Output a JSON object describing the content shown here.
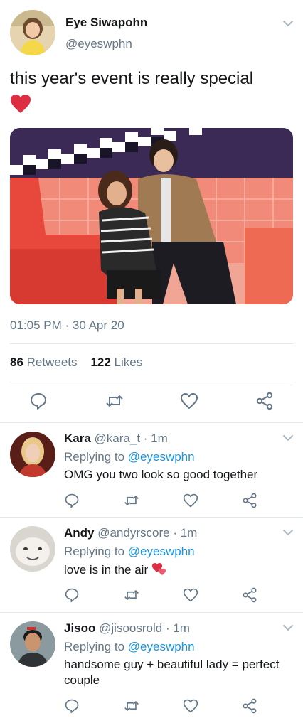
{
  "tweet": {
    "author_name": "Eye Siwapohn",
    "author_handle": "@eyeswphn",
    "text": "this year's event is really special",
    "emoji": "❤️",
    "timestamp": "01:05 PM · 30 Apr 20",
    "retweet_count": "86",
    "retweet_label": "Retweets",
    "like_count": "122",
    "like_label": "Likes"
  },
  "replies": [
    {
      "name": "Kara",
      "handle": "@kara_t",
      "time": "· 1m",
      "replying_prefix": "Replying to ",
      "replying_to": "@eyeswphn",
      "text": "OMG you two look so good together"
    },
    {
      "name": "Andy",
      "handle": "@andyrscore",
      "time": "· 1m",
      "replying_prefix": "Replying to ",
      "replying_to": "@eyeswphn",
      "text": "love is in the air",
      "emoji": "💞"
    },
    {
      "name": "Jisoo",
      "handle": "@jisoosrold",
      "time": "· 1m",
      "replying_prefix": "Replying to ",
      "replying_to": "@eyeswphn",
      "text": "handsome guy + beautiful lady = perfect couple"
    }
  ],
  "colors": {
    "link": "#1b95e0",
    "secondary_text": "#657786",
    "divider": "#e1e8ed",
    "icon": "#657786"
  },
  "icons": [
    "chevron-down-icon",
    "reply-icon",
    "retweet-icon",
    "like-icon",
    "share-icon"
  ]
}
